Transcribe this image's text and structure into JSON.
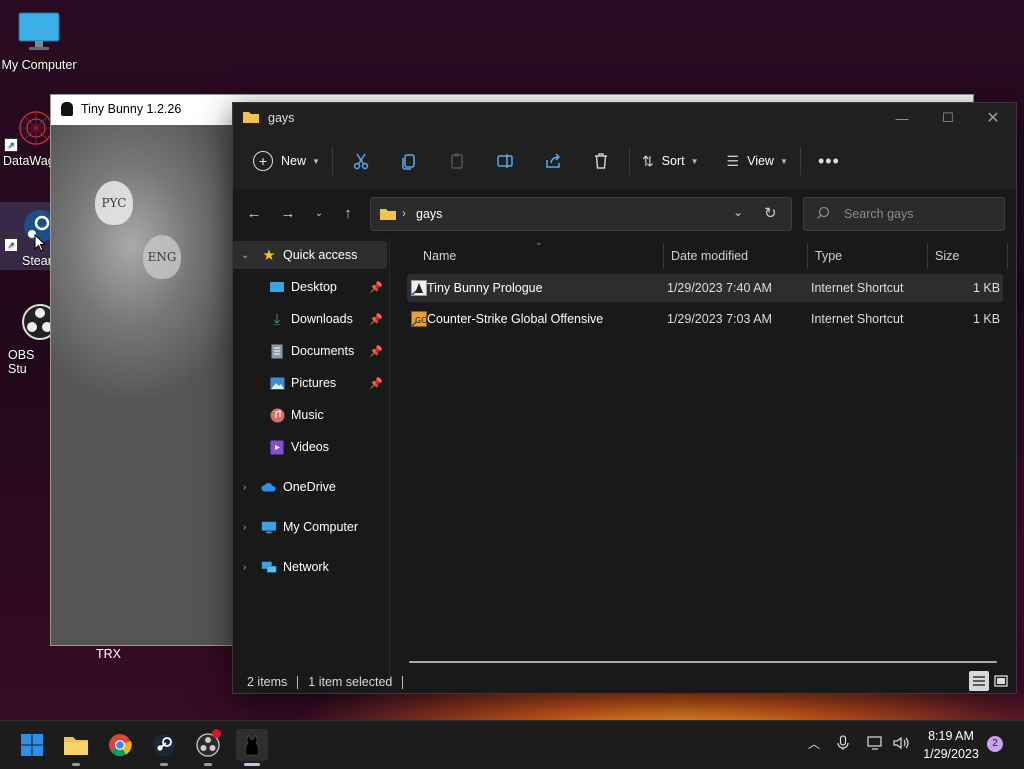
{
  "desktop": {
    "icons": [
      {
        "label": "My Computer"
      },
      {
        "label": "DataWag"
      },
      {
        "label": "Steam"
      },
      {
        "label": "OBS Stu"
      }
    ],
    "trx_label": "TRX"
  },
  "game_window": {
    "title": "Tiny Bunny 1.2.26",
    "paw_left_text": "PYC",
    "paw_right_text": "ENG"
  },
  "explorer": {
    "title": "gays",
    "toolbar": {
      "new_label": "New",
      "sort_label": "Sort",
      "view_label": "View"
    },
    "address": {
      "path_segment": "gays",
      "search_placeholder": "Search gays"
    },
    "nav": {
      "quick_access": "Quick access",
      "items": [
        {
          "label": "Desktop",
          "pinned": true
        },
        {
          "label": "Downloads",
          "pinned": true
        },
        {
          "label": "Documents",
          "pinned": true
        },
        {
          "label": "Pictures",
          "pinned": true
        },
        {
          "label": "Music",
          "pinned": false
        },
        {
          "label": "Videos",
          "pinned": false
        }
      ],
      "onedrive": "OneDrive",
      "my_computer": "My Computer",
      "network": "Network"
    },
    "columns": {
      "name": "Name",
      "date": "Date modified",
      "type": "Type",
      "size": "Size"
    },
    "files": [
      {
        "name": "Tiny Bunny Prologue",
        "date": "1/29/2023 7:40 AM",
        "type": "Internet Shortcut",
        "size": "1 KB",
        "selected": true
      },
      {
        "name": "Counter-Strike Global Offensive",
        "date": "1/29/2023 7:03 AM",
        "type": "Internet Shortcut",
        "size": "1 KB",
        "selected": false
      }
    ],
    "status": {
      "items": "2 items",
      "selected": "1 item selected"
    }
  },
  "taskbar": {
    "time": "8:19 AM",
    "date": "1/29/2023",
    "notification_count": "2"
  },
  "colors": {
    "accent_blue": "#2f8fe8",
    "folder_yellow": "#f2c14e",
    "star_yellow": "#f5c518"
  }
}
